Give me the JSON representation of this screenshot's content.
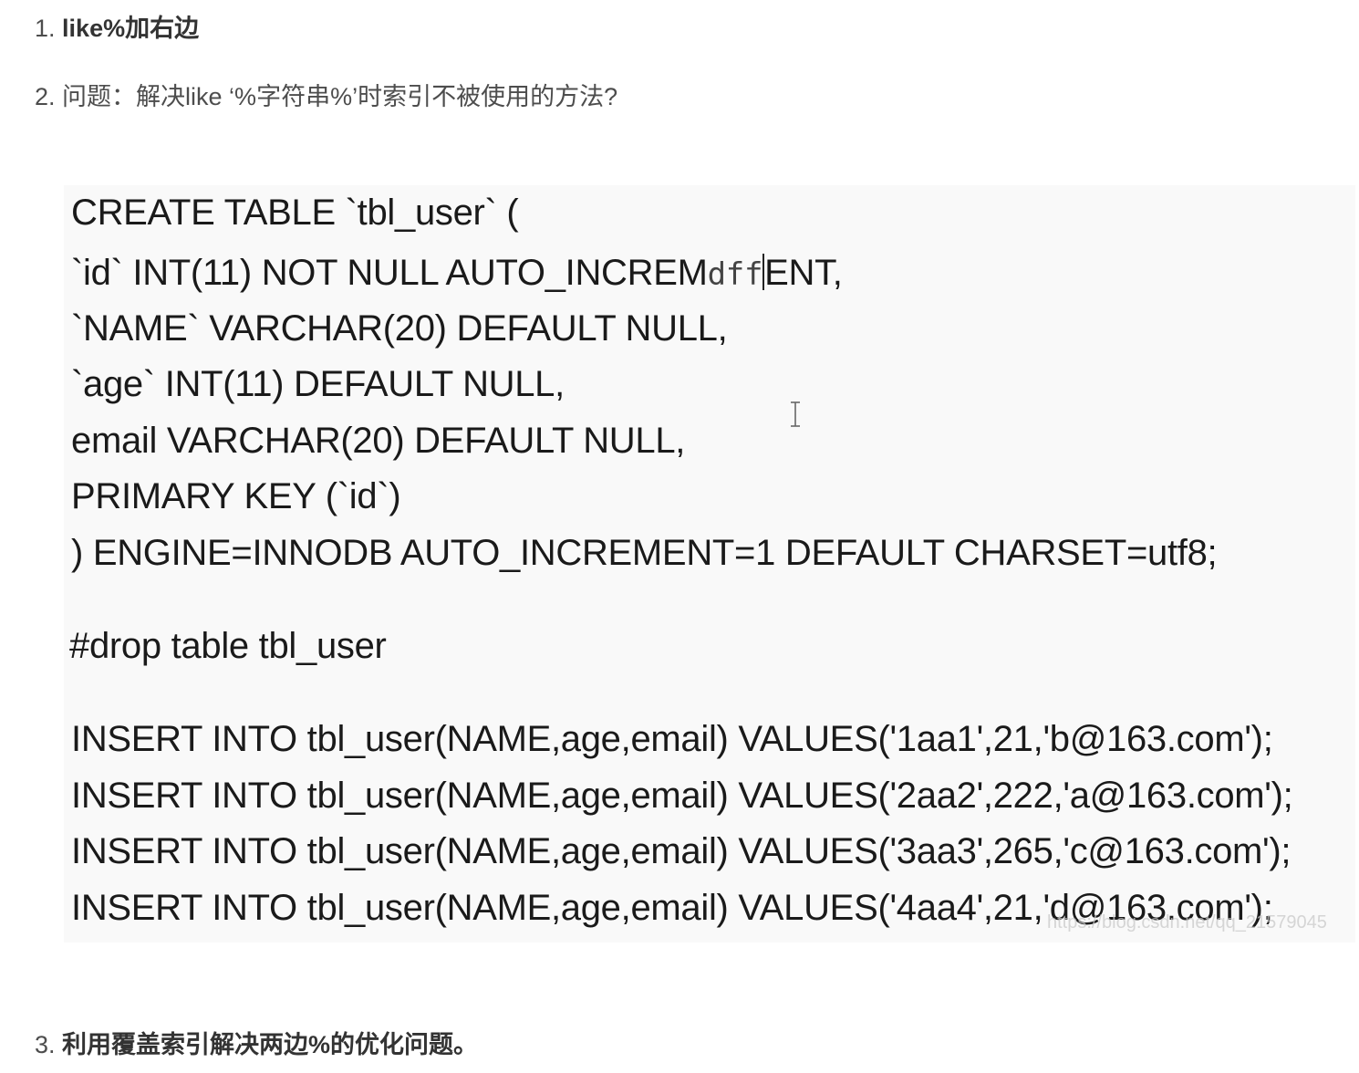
{
  "items": [
    {
      "number": "1.",
      "text": "like%加右边"
    },
    {
      "number": "2.",
      "text": "问题：解决like ‘%字符串%’时索引不被使用的方法?"
    },
    {
      "number": "3.",
      "text": "利用覆盖索引解决两边%的优化问题。"
    }
  ],
  "code": {
    "line1": "CREATE TABLE `tbl_user` (",
    "line2_a": " `id` INT(11) NOT NULL AUTO_INCREM",
    "line2_typed": "dff",
    "line2_b": "ENT,",
    "line3": " `NAME` VARCHAR(20) DEFAULT NULL,",
    "line4": " `age` INT(11) DEFAULT NULL,",
    "line5": " email VARCHAR(20) DEFAULT NULL,",
    "line6": " PRIMARY KEY (`id`)",
    "line7": ") ENGINE=INNODB AUTO_INCREMENT=1 DEFAULT CHARSET=utf8;",
    "line8": "#drop table tbl_user",
    "line9": "INSERT INTO tbl_user(NAME,age,email) VALUES('1aa1',21,'b@163.com');",
    "line10": "INSERT INTO tbl_user(NAME,age,email) VALUES('2aa2',222,'a@163.com');",
    "line11": "INSERT INTO tbl_user(NAME,age,email) VALUES('3aa3',265,'c@163.com');",
    "line12": "INSERT INTO tbl_user(NAME,age,email) VALUES('4aa4',21,'d@163.com');"
  },
  "watermark": "https://blog.csdn.net/qq_21579045"
}
